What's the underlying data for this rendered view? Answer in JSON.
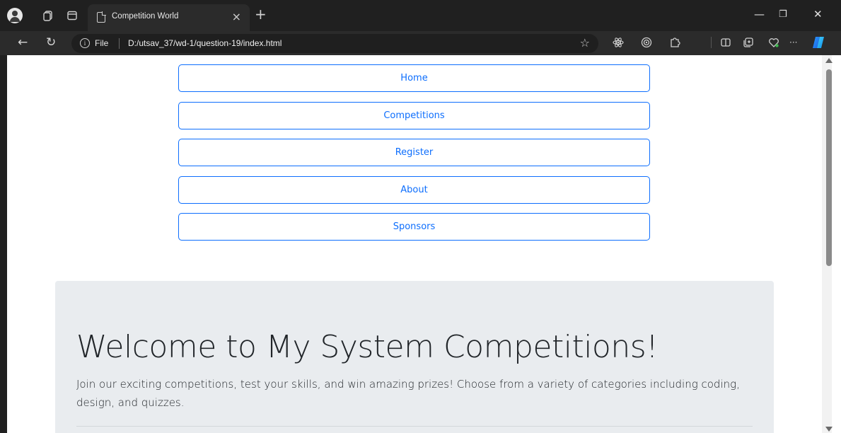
{
  "browser": {
    "tab_title": "Competition World",
    "tab_close": "×",
    "new_tab": "+",
    "file_label": "File",
    "url": "D:/utsav_37/wd-1/question-19/index.html",
    "icons": {
      "back": "←",
      "refresh": "↻",
      "info": "i",
      "star": "☆",
      "minimize": "—",
      "restore": "❐",
      "close": "✕",
      "more": "···"
    }
  },
  "nav": {
    "items": [
      {
        "label": "Home"
      },
      {
        "label": "Competitions"
      },
      {
        "label": "Register"
      },
      {
        "label": "About"
      },
      {
        "label": "Sponsors"
      }
    ]
  },
  "hero": {
    "title": "Welcome to My System Competitions!",
    "lead": "Join our exciting competitions, test your skills, and win amazing prizes! Choose from a variety of categories including coding, design, and quizzes."
  },
  "colors": {
    "link": "#0d6efd",
    "jumbotron_bg": "#e9ecef",
    "chrome_bg": "#202020"
  }
}
